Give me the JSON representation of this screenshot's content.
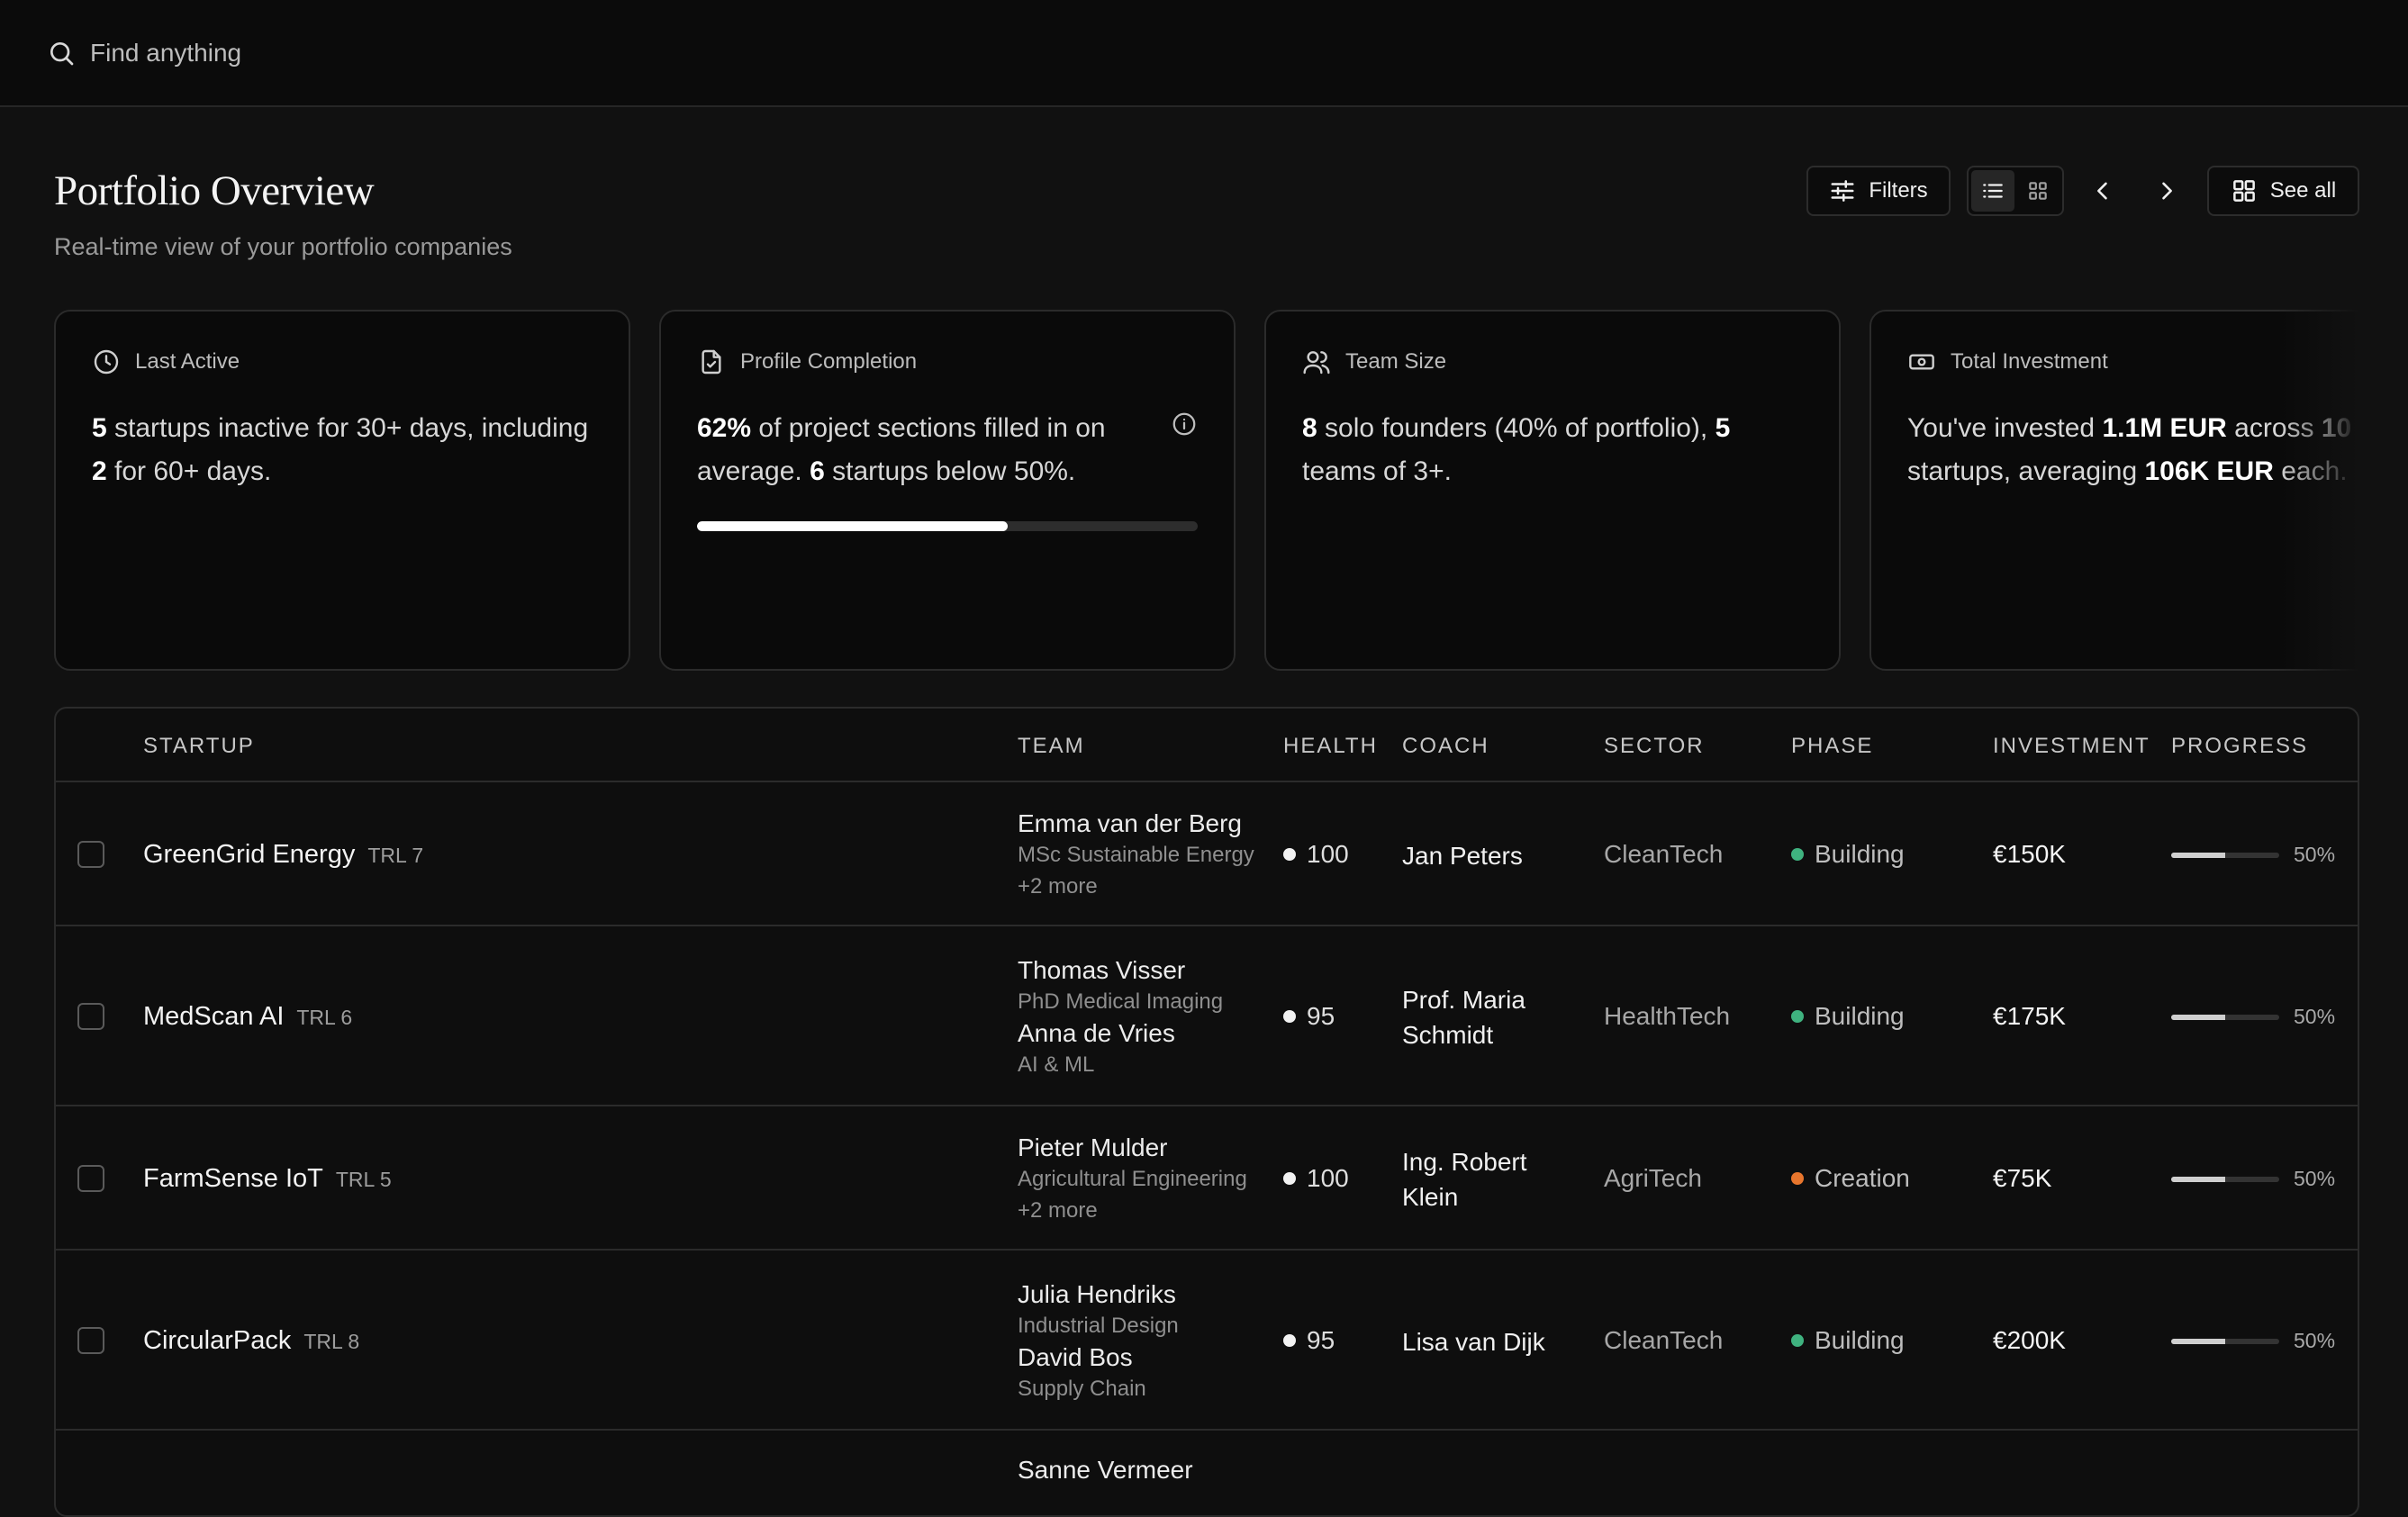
{
  "search": {
    "placeholder": "Find anything"
  },
  "header": {
    "title": "Portfolio Overview",
    "subtitle": "Real-time view of your portfolio companies"
  },
  "toolbar": {
    "filters_label": "Filters",
    "see_all_label": "See all",
    "view_mode": "list"
  },
  "cards": [
    {
      "title": "Last Active",
      "icon": "clock-icon",
      "body": [
        {
          "b": "5"
        },
        {
          "t": " startups inactive for 30+ days, including "
        },
        {
          "b": "2"
        },
        {
          "t": " for 60+ days."
        }
      ]
    },
    {
      "title": "Profile Completion",
      "icon": "document-check-icon",
      "body": [
        {
          "b": "62%"
        },
        {
          "t": " of project sections filled in on average. "
        },
        {
          "b": "6"
        },
        {
          "t": " startups below 50%."
        }
      ],
      "progress": 0.62
    },
    {
      "title": "Team Size",
      "icon": "users-icon",
      "body": [
        {
          "b": "8"
        },
        {
          "t": " solo founders (40% of portfolio), "
        },
        {
          "b": "5"
        },
        {
          "t": " teams of 3+."
        }
      ]
    },
    {
      "title": "Total Investment",
      "icon": "banknote-icon",
      "body": [
        {
          "t": "You've invested "
        },
        {
          "b": "1.1M EUR"
        },
        {
          "t": " across "
        },
        {
          "b": "10"
        },
        {
          "t": " startups, averaging "
        },
        {
          "b": "106K EUR"
        },
        {
          "t": " each."
        }
      ]
    }
  ],
  "table": {
    "columns": {
      "startup": "STARTUP",
      "team": "TEAM",
      "health": "HEALTH",
      "coach": "COACH",
      "sector": "SECTOR",
      "phase": "PHASE",
      "investment": "INVESTMENT",
      "progress": "PROGRESS"
    },
    "rows": [
      {
        "name": "GreenGrid Energy",
        "trl": "TRL 7",
        "team": [
          {
            "name": "Emma van der Berg",
            "role": "MSc Sustainable Energy"
          }
        ],
        "more": "+2 more",
        "health": "100",
        "coach": [
          "Jan Peters"
        ],
        "sector": "CleanTech",
        "phase": "Building",
        "phase_color": "#3fb27f",
        "investment": "€150K",
        "progress": 0.5,
        "progress_label": "50%"
      },
      {
        "name": "MedScan AI",
        "trl": "TRL 6",
        "team": [
          {
            "name": "Thomas Visser",
            "role": "PhD Medical Imaging"
          },
          {
            "name": "Anna de Vries",
            "role": "AI & ML"
          }
        ],
        "more": "",
        "health": "95",
        "coach": [
          "Prof. Maria",
          "Schmidt"
        ],
        "sector": "HealthTech",
        "phase": "Building",
        "phase_color": "#3fb27f",
        "investment": "€175K",
        "progress": 0.5,
        "progress_label": "50%"
      },
      {
        "name": "FarmSense IoT",
        "trl": "TRL 5",
        "team": [
          {
            "name": "Pieter Mulder",
            "role": "Agricultural Engineering"
          }
        ],
        "more": "+2 more",
        "health": "100",
        "coach": [
          "Ing. Robert",
          "Klein"
        ],
        "sector": "AgriTech",
        "phase": "Creation",
        "phase_color": "#e8762d",
        "investment": "€75K",
        "progress": 0.5,
        "progress_label": "50%"
      },
      {
        "name": "CircularPack",
        "trl": "TRL 8",
        "team": [
          {
            "name": "Julia Hendriks",
            "role": "Industrial Design"
          },
          {
            "name": "David Bos",
            "role": "Supply Chain"
          }
        ],
        "more": "",
        "health": "95",
        "coach": [
          "Lisa van Dijk"
        ],
        "sector": "CleanTech",
        "phase": "Building",
        "phase_color": "#3fb27f",
        "investment": "€200K",
        "progress": 0.5,
        "progress_label": "50%"
      },
      {
        "name": "",
        "trl": "",
        "team": [
          {
            "name": "Sanne Vermeer",
            "role": ""
          }
        ],
        "more": "",
        "health": "",
        "coach": [],
        "sector": "",
        "phase": "",
        "phase_color": "",
        "investment": "",
        "progress": null,
        "progress_label": ""
      }
    ]
  }
}
